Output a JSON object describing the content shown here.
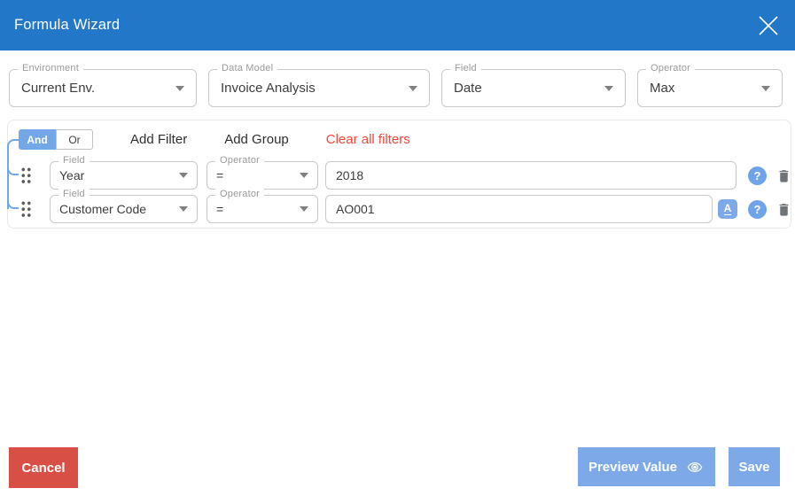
{
  "dialog": {
    "title": "Formula Wizard"
  },
  "selectors": [
    {
      "label": "Environment",
      "value": "Current Env."
    },
    {
      "label": "Data Model",
      "value": "Invoice Analysis"
    },
    {
      "label": "Field",
      "value": "Date"
    },
    {
      "label": "Operator",
      "value": "Max"
    }
  ],
  "filter_toolbar": {
    "and_label": "And",
    "or_label": "Or",
    "add_filter_label": "Add Filter",
    "add_group_label": "Add Group",
    "clear_label": "Clear all filters"
  },
  "filters": [
    {
      "field_label": "Field",
      "field_value": "Year",
      "operator_label": "Operator",
      "operator_value": "=",
      "value": "2018"
    },
    {
      "field_label": "Field",
      "field_value": "Customer Code",
      "operator_label": "Operator",
      "operator_value": "=",
      "value": "AO001"
    }
  ],
  "icons": {
    "help_glyph": "?",
    "text_format_glyph": "A"
  },
  "footer": {
    "cancel_label": "Cancel",
    "preview_label": "Preview Value",
    "save_label": "Save"
  },
  "colors": {
    "header_blue": "#2277C8",
    "accent_blue": "#74A7E8",
    "button_blue": "#7DA9E9",
    "cancel_red": "#D85045",
    "clear_red": "#F0483E"
  }
}
